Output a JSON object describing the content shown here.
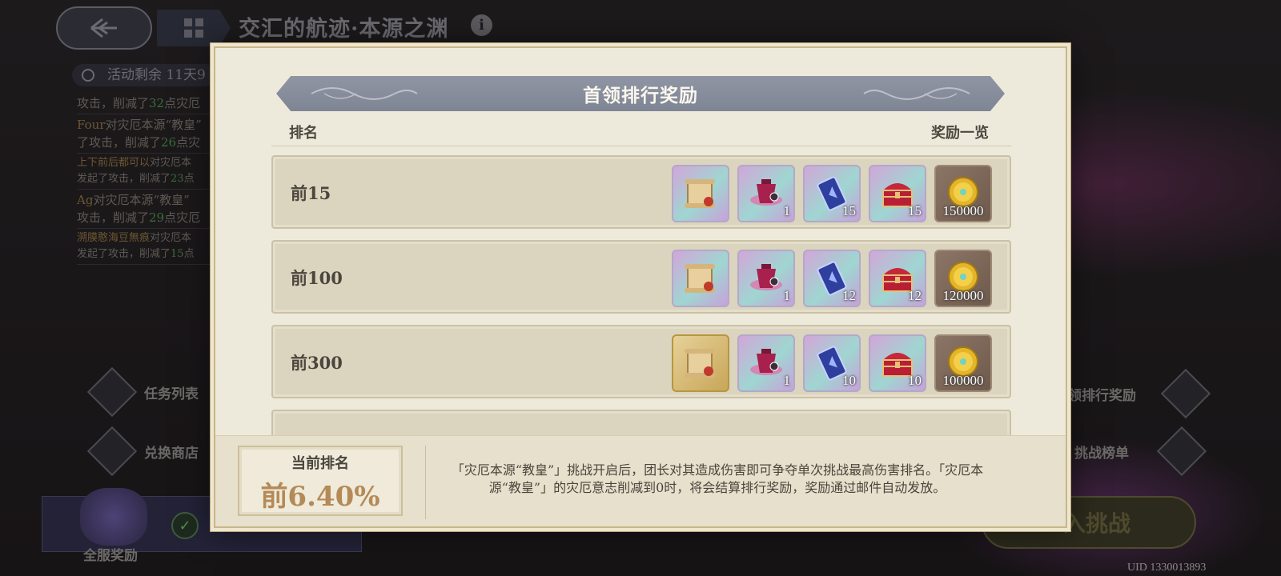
{
  "background": {
    "event_title": "交汇的航迹·本源之渊",
    "timer_text": "活动剩余 11天9",
    "log_entries": [
      {
        "name": "",
        "text": "攻击，削减了",
        "num": "32",
        "tail": "点灾厄"
      },
      {
        "name": "Four",
        "text": "对灾厄本源“教皇”",
        "line2": "了攻击，削减了",
        "num": "26",
        "tail": "点灾"
      },
      {
        "name": "上下前后都可以",
        "text": "对灾厄本",
        "line2": "发起了攻击，削减了",
        "num": "23",
        "tail": "点"
      },
      {
        "name": "Ag",
        "text": "对灾厄本源“教皇”",
        "line2": "攻击，削减了",
        "num": "29",
        "tail": "点灾厄"
      },
      {
        "name": "溯膜憨海豆無痕",
        "text": "对灾厄本",
        "line2": "发起了攻击，削减了",
        "num": "15",
        "tail": "点"
      }
    ],
    "task_list": "任务列表",
    "exchange_shop": "兑换商店",
    "server_reward": "全服奖励",
    "ranking_reward": "领排行奖励",
    "challenge_board": "挑战榜单",
    "enter_challenge": "入挑战",
    "uid": "UID 1330013893"
  },
  "modal": {
    "title": "首领排行奖励",
    "col_rank": "排名",
    "col_rewards": "奖励一览",
    "rows": [
      {
        "label": "前15",
        "items": [
          {
            "icon": "scroll-icon",
            "qty": "",
            "style": "pink"
          },
          {
            "icon": "lantern-icon",
            "qty": "1",
            "style": "pink"
          },
          {
            "icon": "ticket-icon",
            "qty": "15",
            "style": "pink"
          },
          {
            "icon": "treasure-chest-icon",
            "qty": "15",
            "style": "pink"
          },
          {
            "icon": "gold-coin-icon",
            "qty": "150000",
            "style": "brown"
          }
        ]
      },
      {
        "label": "前100",
        "items": [
          {
            "icon": "scroll-icon",
            "qty": "",
            "style": "pink"
          },
          {
            "icon": "lantern-icon",
            "qty": "1",
            "style": "pink"
          },
          {
            "icon": "ticket-icon",
            "qty": "12",
            "style": "pink"
          },
          {
            "icon": "treasure-chest-icon",
            "qty": "12",
            "style": "pink"
          },
          {
            "icon": "gold-coin-icon",
            "qty": "120000",
            "style": "brown"
          }
        ]
      },
      {
        "label": "前300",
        "items": [
          {
            "icon": "scroll-icon",
            "qty": "",
            "style": "gold"
          },
          {
            "icon": "lantern-icon",
            "qty": "1",
            "style": "pink"
          },
          {
            "icon": "ticket-icon",
            "qty": "10",
            "style": "pink"
          },
          {
            "icon": "treasure-chest-icon",
            "qty": "10",
            "style": "pink"
          },
          {
            "icon": "gold-coin-icon",
            "qty": "100000",
            "style": "brown"
          }
        ]
      }
    ],
    "current_rank_label": "当前排名",
    "current_rank_value": "前6.40%",
    "description": "「灾厄本源“教皇”」挑战开启后，团长对其造成伤害即可争夺单次挑战最高伤害排名。「灾厄本源“教皇”」的灾厄意志削减到0时，将会结算排行奖励，奖励通过邮件自动发放。"
  },
  "colors": {
    "modal_bg": "#eeeadb",
    "title_bar": "#8a909e",
    "row_bg": "#dbd4be",
    "rank_value": "#b48a58"
  }
}
